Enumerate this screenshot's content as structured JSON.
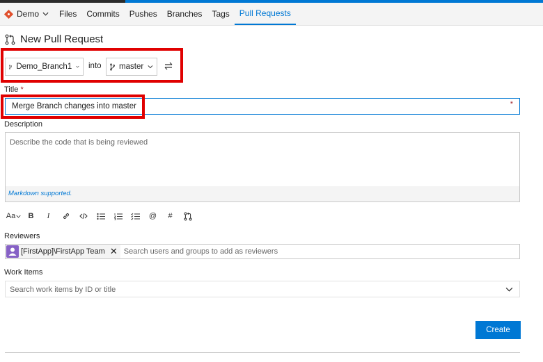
{
  "nav": {
    "project": "Demo",
    "tabs": [
      "Files",
      "Commits",
      "Pushes",
      "Branches",
      "Tags",
      "Pull Requests"
    ],
    "active_tab": "Pull Requests"
  },
  "page": {
    "title": "New Pull Request"
  },
  "branches": {
    "source": "Demo_Branch1",
    "into_label": "into",
    "target": "master"
  },
  "form": {
    "title_label": "Title",
    "required_marker": "*",
    "title_value": "Merge Branch changes into master",
    "description_label": "Description",
    "description_placeholder": "Describe the code that is being reviewed",
    "markdown_note": "Markdown supported.",
    "reviewers_label": "Reviewers",
    "reviewer_chip": "[FirstApp]\\FirstApp Team",
    "reviewers_placeholder": "Search users and groups to add as reviewers",
    "work_items_label": "Work Items",
    "work_items_placeholder": "Search work items by ID or title",
    "create_label": "Create"
  },
  "toolbar": {
    "font_size": "Aa",
    "bold": "B",
    "italic": "I",
    "mention": "@",
    "hash": "#",
    "icons": [
      "font-size-icon",
      "bold-icon",
      "italic-icon",
      "link-icon",
      "code-icon",
      "bulleted-list-icon",
      "numbered-list-icon",
      "checklist-icon",
      "mention-icon",
      "hash-icon",
      "pull-request-icon"
    ]
  },
  "colors": {
    "accent": "#0078d4",
    "highlight": "#e00000",
    "required": "#a4262c"
  }
}
